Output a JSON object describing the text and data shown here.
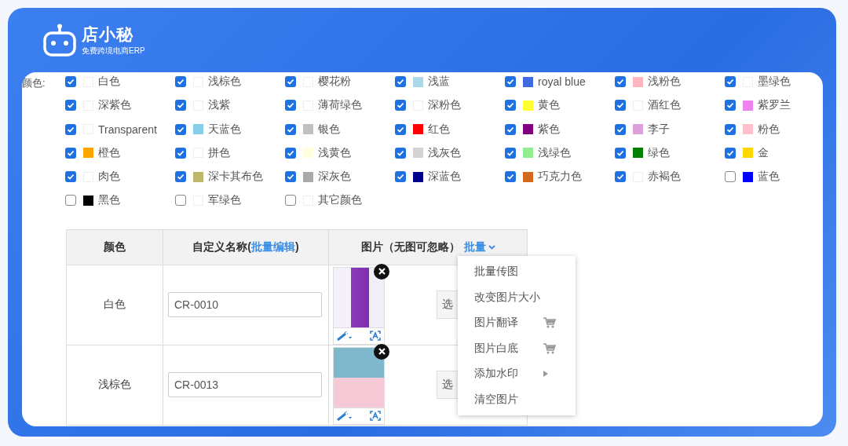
{
  "logo": {
    "name": "店小秘",
    "tagline": "免费跨境电商ERP"
  },
  "color_filter": {
    "label": "颜色:",
    "options": [
      {
        "label": "白色",
        "checked": true,
        "color": "#ffffff"
      },
      {
        "label": "浅棕色",
        "checked": true,
        "color": "#ffffff"
      },
      {
        "label": "樱花粉",
        "checked": true,
        "color": "#ffffff"
      },
      {
        "label": "浅蓝",
        "checked": true,
        "color": "#add8e6"
      },
      {
        "label": "royal blue",
        "checked": true,
        "color": "#4169e1"
      },
      {
        "label": "浅粉色",
        "checked": true,
        "color": "#ffb6c1"
      },
      {
        "label": "墨绿色",
        "checked": true,
        "color": "#ffffff"
      },
      {
        "label": "深紫色",
        "checked": true,
        "color": "#ffffff"
      },
      {
        "label": "浅紫",
        "checked": true,
        "color": "#ffffff"
      },
      {
        "label": "薄荷绿色",
        "checked": true,
        "color": "#ffffff"
      },
      {
        "label": "深粉色",
        "checked": true,
        "color": "#ffffff"
      },
      {
        "label": "黄色",
        "checked": true,
        "color": "#ffff33"
      },
      {
        "label": "酒红色",
        "checked": true,
        "color": "#ffffff"
      },
      {
        "label": "紫罗兰",
        "checked": true,
        "color": "#ee82ee"
      },
      {
        "label": "Transparent",
        "checked": true,
        "color": "#ffffff"
      },
      {
        "label": "天蓝色",
        "checked": true,
        "color": "#87ceeb"
      },
      {
        "label": "银色",
        "checked": true,
        "color": "#c0c0c0"
      },
      {
        "label": "红色",
        "checked": true,
        "color": "#ff0000"
      },
      {
        "label": "紫色",
        "checked": true,
        "color": "#800080"
      },
      {
        "label": "李子",
        "checked": true,
        "color": "#dda0dd"
      },
      {
        "label": "粉色",
        "checked": true,
        "color": "#ffc0cb"
      },
      {
        "label": "橙色",
        "checked": true,
        "color": "#ffa500"
      },
      {
        "label": "拼色",
        "checked": true,
        "color": "#ffffff"
      },
      {
        "label": "浅黄色",
        "checked": true,
        "color": "#ffffe0"
      },
      {
        "label": "浅灰色",
        "checked": true,
        "color": "#d3d3d3"
      },
      {
        "label": "浅绿色",
        "checked": true,
        "color": "#90ee90"
      },
      {
        "label": "绿色",
        "checked": true,
        "color": "#008000"
      },
      {
        "label": "金",
        "checked": true,
        "color": "#ffd700"
      },
      {
        "label": "肉色",
        "checked": true,
        "color": "#ffffff"
      },
      {
        "label": "深卡其布色",
        "checked": true,
        "color": "#bdb76b"
      },
      {
        "label": "深灰色",
        "checked": true,
        "color": "#a9a9a9"
      },
      {
        "label": "深蓝色",
        "checked": true,
        "color": "#00008b"
      },
      {
        "label": "巧克力色",
        "checked": true,
        "color": "#d2691e"
      },
      {
        "label": "赤褐色",
        "checked": true,
        "color": "#ffffff"
      },
      {
        "label": "蓝色",
        "checked": false,
        "color": "#0000ff"
      },
      {
        "label": "黑色",
        "checked": false,
        "color": "#000000"
      },
      {
        "label": "军绿色",
        "checked": false,
        "color": "#ffffff"
      },
      {
        "label": "其它颜色",
        "checked": false,
        "color": "#ffffff"
      }
    ]
  },
  "table": {
    "columns": [
      {
        "label": "颜色"
      },
      {
        "label": "自定义名称(",
        "link": "批量编辑",
        "suffix": ")"
      },
      {
        "label": "图片（无图可忽略）",
        "link": "批量"
      }
    ],
    "rows": [
      {
        "color_name": "白色",
        "custom_name": "CR-0010",
        "button": "选"
      },
      {
        "color_name": "浅棕色",
        "custom_name": "CR-0013",
        "button": "选"
      }
    ]
  },
  "batch_menu": {
    "items": [
      {
        "label": "批量传图",
        "kind": "plain"
      },
      {
        "label": "改变图片大小",
        "kind": "plain"
      },
      {
        "label": "图片翻译",
        "kind": "paid"
      },
      {
        "label": "图片白底",
        "kind": "paid"
      },
      {
        "label": "添加水印",
        "kind": "submenu"
      },
      {
        "label": "清空图片",
        "kind": "plain"
      }
    ]
  }
}
